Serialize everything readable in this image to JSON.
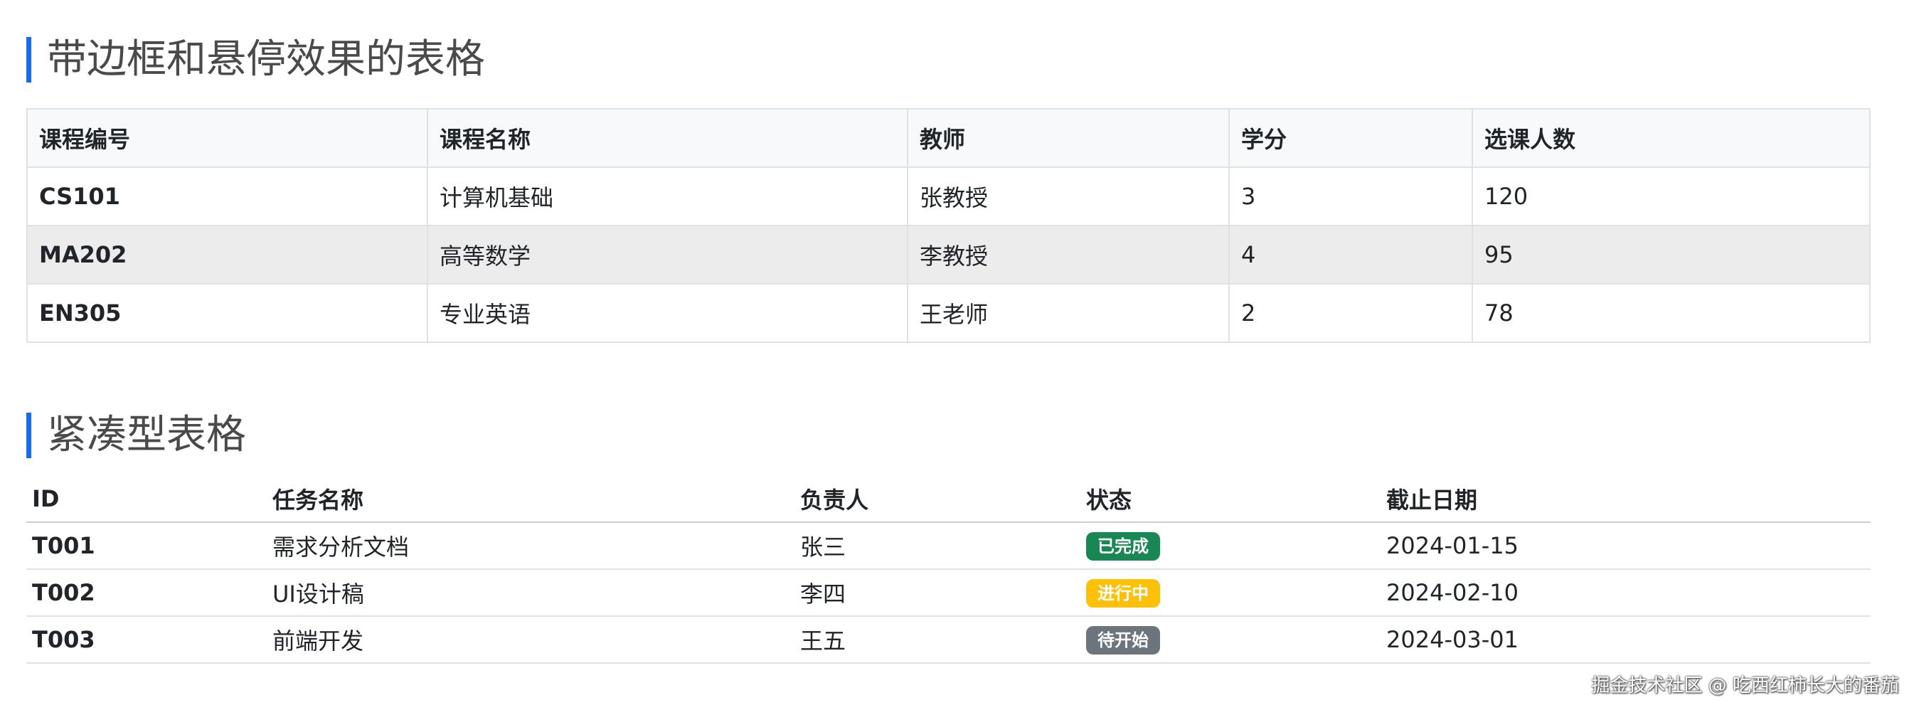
{
  "section1": {
    "title": "带边框和悬停效果的表格",
    "headers": [
      "课程编号",
      "课程名称",
      "教师",
      "学分",
      "选课人数"
    ],
    "rows": [
      {
        "code": "CS101",
        "name": "计算机基础",
        "teacher": "张教授",
        "credits": "3",
        "enrolled": "120"
      },
      {
        "code": "MA202",
        "name": "高等数学",
        "teacher": "李教授",
        "credits": "4",
        "enrolled": "95"
      },
      {
        "code": "EN305",
        "name": "专业英语",
        "teacher": "王老师",
        "credits": "2",
        "enrolled": "78"
      }
    ]
  },
  "section2": {
    "title": "紧凑型表格",
    "headers": [
      "ID",
      "任务名称",
      "负责人",
      "状态",
      "截止日期"
    ],
    "rows": [
      {
        "id": "T001",
        "task": "需求分析文档",
        "owner": "张三",
        "status": "已完成",
        "deadline": "2024-01-15"
      },
      {
        "id": "T002",
        "task": "UI设计稿",
        "owner": "李四",
        "status": "进行中",
        "deadline": "2024-02-10"
      },
      {
        "id": "T003",
        "task": "前端开发",
        "owner": "王五",
        "status": "待开始",
        "deadline": "2024-03-01"
      }
    ]
  },
  "colors": {
    "accent": "#0d6efd",
    "success": "#198754",
    "warning": "#ffc107",
    "secondary": "#6c757d",
    "hover_row": "#ececec",
    "header_bg": "#f8f9fa",
    "border": "#dee2e6"
  },
  "watermark": "掘金技术社区 @ 吃西红柿长大的番茄"
}
